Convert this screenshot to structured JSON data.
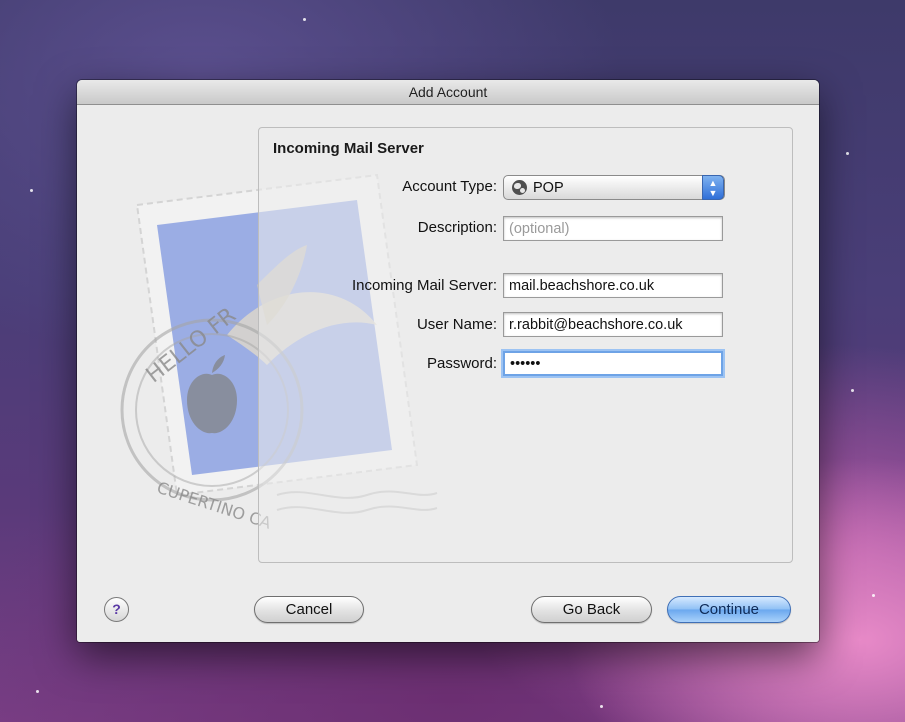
{
  "window": {
    "title": "Add Account"
  },
  "form": {
    "heading": "Incoming Mail Server",
    "account_type": {
      "label": "Account Type:",
      "value": "POP",
      "icon": "globe-icon"
    },
    "description": {
      "label": "Description:",
      "placeholder": "(optional)",
      "value": ""
    },
    "incoming_server": {
      "label": "Incoming Mail Server:",
      "value": "mail.beachshore.co.uk"
    },
    "user_name": {
      "label": "User Name:",
      "value": "r.rabbit@beachshore.co.uk"
    },
    "password": {
      "label": "Password:",
      "value": "••••••"
    }
  },
  "buttons": {
    "help": "?",
    "cancel": "Cancel",
    "go_back": "Go Back",
    "continue": "Continue"
  },
  "stamp": {
    "text_top": "HELLO FR",
    "text_bottom": "CUPERTINO CA"
  },
  "colors": {
    "accent": "#6aa7ee",
    "focus_ring": "#9cc3f3",
    "help_glyph": "#5b3aa6"
  }
}
